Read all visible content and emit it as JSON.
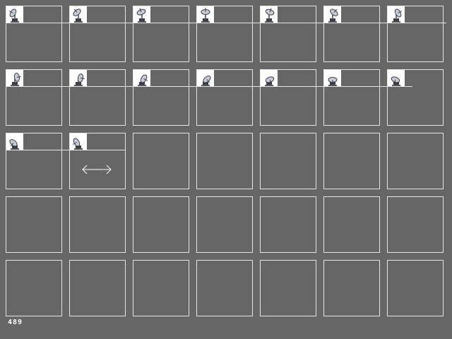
{
  "colors": {
    "background": "#666666",
    "cell_border": "#e6e6e6",
    "thumb_bg": "#ffffff",
    "sprite_dark": "#3c3c46",
    "sprite_light": "#c8ccd8"
  },
  "grid": {
    "columns": 7,
    "rows": 5
  },
  "frames": [
    {
      "icon": "satellite-dish-icon",
      "angle": -60
    },
    {
      "icon": "satellite-dish-icon",
      "angle": -40
    },
    {
      "icon": "satellite-dish-icon",
      "angle": -20
    },
    {
      "icon": "satellite-dish-icon",
      "angle": 0
    },
    {
      "icon": "satellite-dish-icon",
      "angle": 20
    },
    {
      "icon": "satellite-dish-icon",
      "angle": 40
    },
    {
      "icon": "satellite-dish-icon",
      "angle": 60
    },
    {
      "icon": "satellite-dish-icon",
      "angle": 80
    },
    {
      "icon": "satellite-dish-icon",
      "angle": 100
    },
    {
      "icon": "satellite-dish-icon",
      "angle": 120
    },
    {
      "icon": "satellite-dish-icon",
      "angle": 140
    },
    {
      "icon": "satellite-dish-icon",
      "angle": 160
    },
    {
      "icon": "satellite-dish-icon",
      "angle": 180
    },
    {
      "icon": "satellite-dish-icon",
      "angle": 200
    },
    {
      "icon": "satellite-dish-icon",
      "angle": 220
    },
    {
      "icon": "satellite-dish-icon",
      "angle": 240
    }
  ],
  "cursor": {
    "icon": "horizontal-resize-cursor-icon"
  },
  "status": {
    "counter": "489"
  }
}
